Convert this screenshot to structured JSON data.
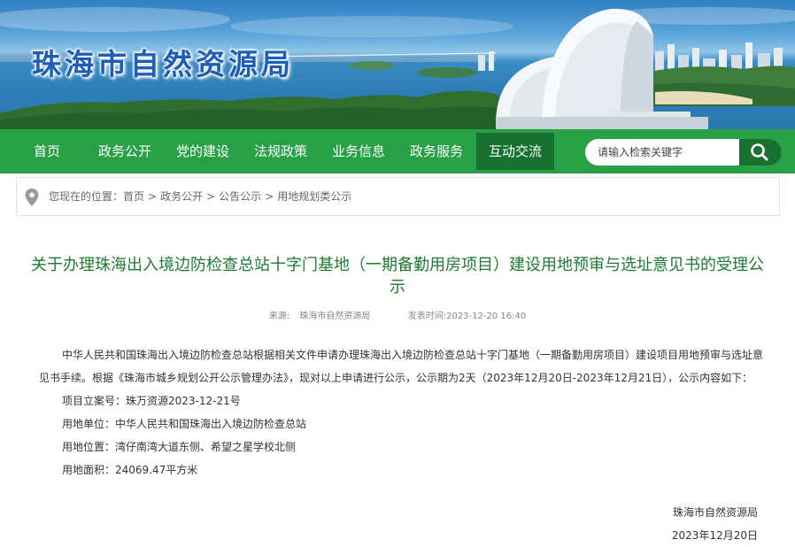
{
  "header": {
    "site_title": "珠海市自然资源局"
  },
  "nav": {
    "items": [
      {
        "label": "首页"
      },
      {
        "label": "政务公开"
      },
      {
        "label": "党的建设"
      },
      {
        "label": "法规政策"
      },
      {
        "label": "业务信息"
      },
      {
        "label": "政务服务"
      },
      {
        "label": "互动交流",
        "active": true
      }
    ],
    "search_placeholder": "请输入检索关键字"
  },
  "breadcrumb": {
    "prefix": "您现在的位置：",
    "items": [
      "首页",
      "政务公开",
      "公告公示",
      "用地规划类公示"
    ],
    "separator": ">"
  },
  "article": {
    "title": "关于办理珠海出入境边防检查总站十字门基地（一期备勤用房项目）建设用地预审与选址意见书的受理公示",
    "source_label": "来源:",
    "source": "珠海市自然资源局",
    "date_label": "发表时间:",
    "date": "2023-12-20 16:40",
    "intro": "中华人民共和国珠海出入境边防检查总站根据相关文件申请办理珠海出入境边防检查总站十字门基地（一期备勤用房项目）建设项目用地预审与选址意见书手续。根据《珠海市城乡规划公开公示管理办法》，现对以上申请进行公示，公示期为2天（2023年12月20日-2023年12月21日），公示内容如下：",
    "fields": [
      {
        "label": "项目立案号：",
        "value": "珠万资源2023-12-21号"
      },
      {
        "label": "用地单位：",
        "value": "中华人民共和国珠海出入境边防检查总站"
      },
      {
        "label": "用地位置：",
        "value": "湾仔南湾大道东侧、希望之星学校北侧"
      },
      {
        "label": "用地面积：",
        "value": "24069.47平方米"
      }
    ],
    "signature_org": "珠海市自然资源局",
    "signature_date": "2023年12月20日"
  },
  "colors": {
    "nav_green": "#27a046",
    "nav_active": "#16722e",
    "title_green": "#1e7b30",
    "site_title_blue": "#1d5fb8"
  },
  "icons": {
    "breadcrumb": "location-pin-icon",
    "search": "search-icon"
  }
}
